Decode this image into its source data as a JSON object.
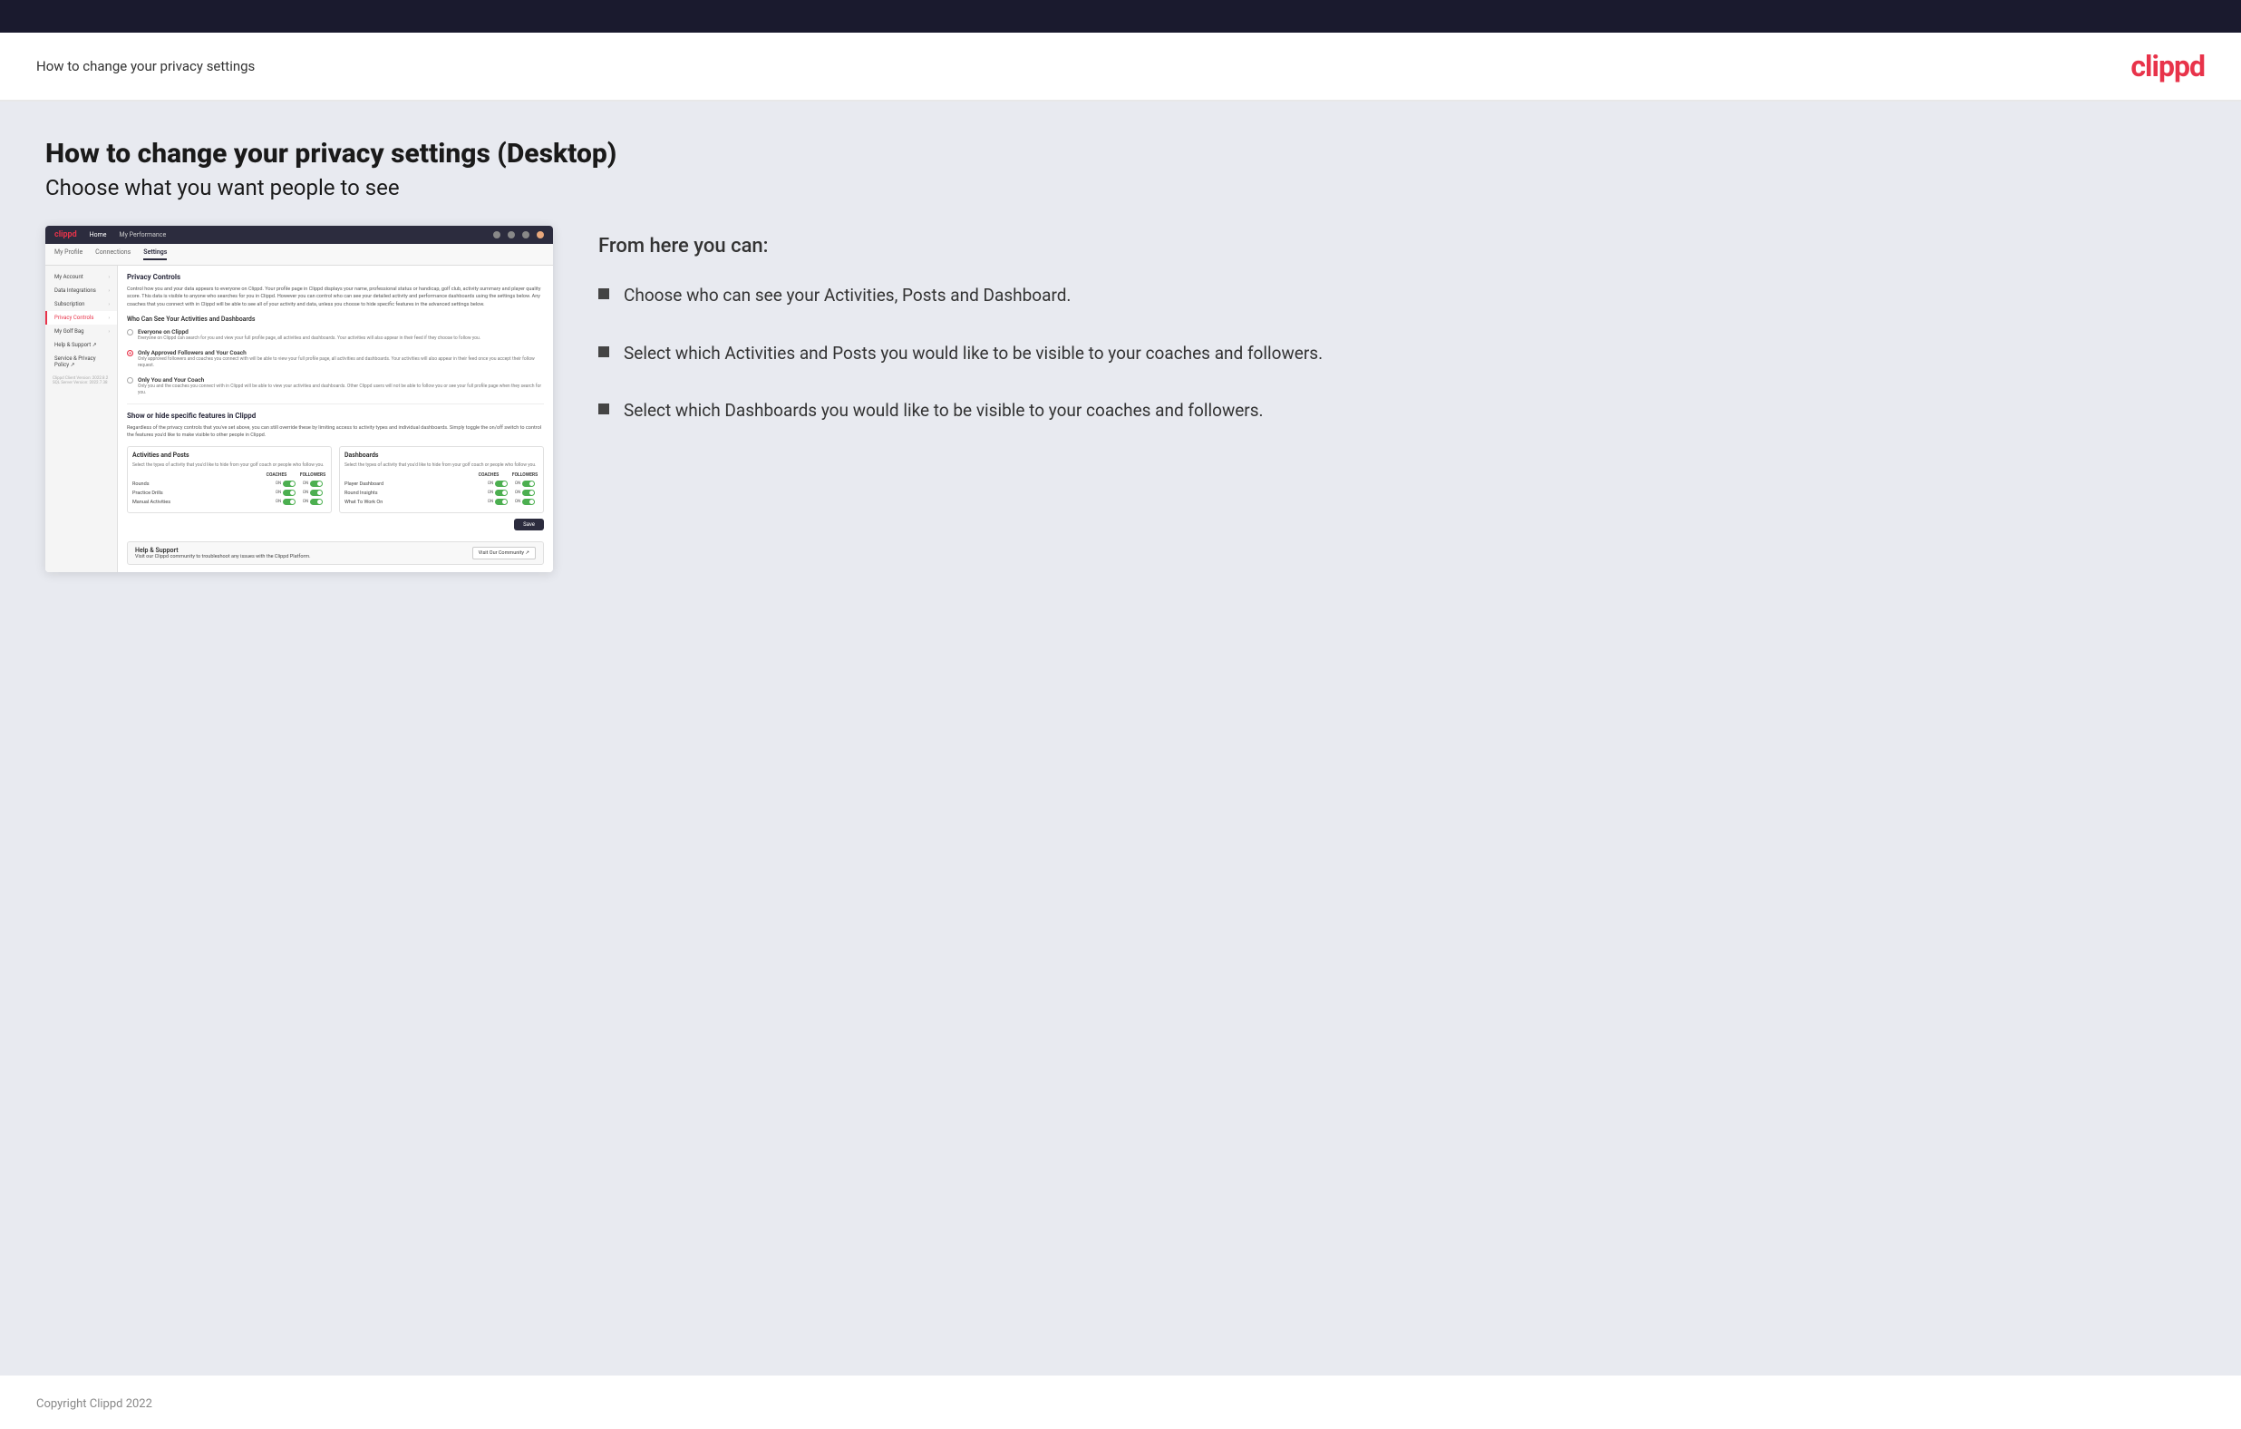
{
  "header": {
    "title": "How to change your privacy settings",
    "logo": "clippd"
  },
  "page": {
    "heading": "How to change your privacy settings (Desktop)",
    "subheading": "Choose what you want people to see"
  },
  "from_here": {
    "title": "From here you can:",
    "bullets": [
      {
        "text": "Choose who can see your Activities, Posts and Dashboard."
      },
      {
        "text": "Select which Activities and Posts you would like to be visible to your coaches and followers."
      },
      {
        "text": "Select which Dashboards you would like to be visible to your coaches and followers."
      }
    ]
  },
  "app_screenshot": {
    "nav": {
      "logo": "clippd",
      "links": [
        "Home",
        "My Performance"
      ]
    },
    "subnav": [
      "My Profile",
      "Connections",
      "Settings"
    ],
    "sidebar": {
      "items": [
        {
          "label": "My Account",
          "active": false
        },
        {
          "label": "Data Integrations",
          "active": false
        },
        {
          "label": "Subscription",
          "active": false
        },
        {
          "label": "Privacy Controls",
          "active": true
        },
        {
          "label": "My Golf Bag",
          "active": false
        },
        {
          "label": "Help & Support",
          "active": false
        },
        {
          "label": "Service & Privacy Policy",
          "active": false
        }
      ]
    },
    "content": {
      "section_title": "Privacy Controls",
      "section_desc": "Control how you and your data appears to everyone on Clippd. Your profile page in Clippd displays your name, professional status or handicap, golf club, activity summary and player quality score. This data is visible to anyone who searches for you in Clippd. However you can control who can see your detailed activity and performance dashboards using the settings below. Any coaches that you connect with in Clippd will be able to see all of your activity and data, unless you choose to hide specific features in the advanced settings below.",
      "who_can_see_title": "Who Can See Your Activities and Dashboards",
      "radio_options": [
        {
          "label": "Everyone on Clippd",
          "desc": "Everyone on Clippd can search for you and view your full profile page, all activities and dashboards. Your activities will also appear in their feed if they choose to follow you.",
          "selected": false
        },
        {
          "label": "Only Approved Followers and Your Coach",
          "desc": "Only approved followers and coaches you connect with will be able to view your full profile page, all activities and dashboards. Your activities will also appear in their feed once you accept their follow request.",
          "selected": true
        },
        {
          "label": "Only You and Your Coach",
          "desc": "Only you and the coaches you connect with in Clippd will be able to view your activities and dashboards. Other Clippd users will not be able to follow you or see your full profile page when they search for you.",
          "selected": false
        }
      ],
      "show_hide_title": "Show or hide specific features in Clippd",
      "show_hide_desc": "Regardless of the privacy controls that you've set above, you can still override these by limiting access to activity types and individual dashboards. Simply toggle the on/off switch to control the features you'd like to make visible to other people in Clippd.",
      "activities_box": {
        "title": "Activities and Posts",
        "desc": "Select the types of activity that you'd like to hide from your golf coach or people who follow you.",
        "col_headers": [
          "COACHES",
          "FOLLOWERS"
        ],
        "rows": [
          {
            "label": "Rounds",
            "coaches_on": true,
            "followers_on": true
          },
          {
            "label": "Practice Drills",
            "coaches_on": true,
            "followers_on": true
          },
          {
            "label": "Manual Activities",
            "coaches_on": true,
            "followers_on": true
          }
        ]
      },
      "dashboards_box": {
        "title": "Dashboards",
        "desc": "Select the types of activity that you'd like to hide from your golf coach or people who follow you.",
        "col_headers": [
          "COACHES",
          "FOLLOWERS"
        ],
        "rows": [
          {
            "label": "Player Dashboard",
            "coaches_on": true,
            "followers_on": true
          },
          {
            "label": "Round Insights",
            "coaches_on": true,
            "followers_on": true
          },
          {
            "label": "What To Work On",
            "coaches_on": true,
            "followers_on": true
          }
        ]
      },
      "save_label": "Save",
      "help_section": {
        "title": "Help & Support",
        "desc": "Visit our Clippd community to troubleshoot any issues with the Clippd Platform.",
        "btn_label": "Visit Our Community"
      },
      "version_text": "Clippd Client Version: 2022.8.2\nSQL Server Version: 2022.7.38"
    }
  },
  "footer": {
    "copyright": "Copyright Clippd 2022"
  },
  "sidebar_account_label": "Account"
}
